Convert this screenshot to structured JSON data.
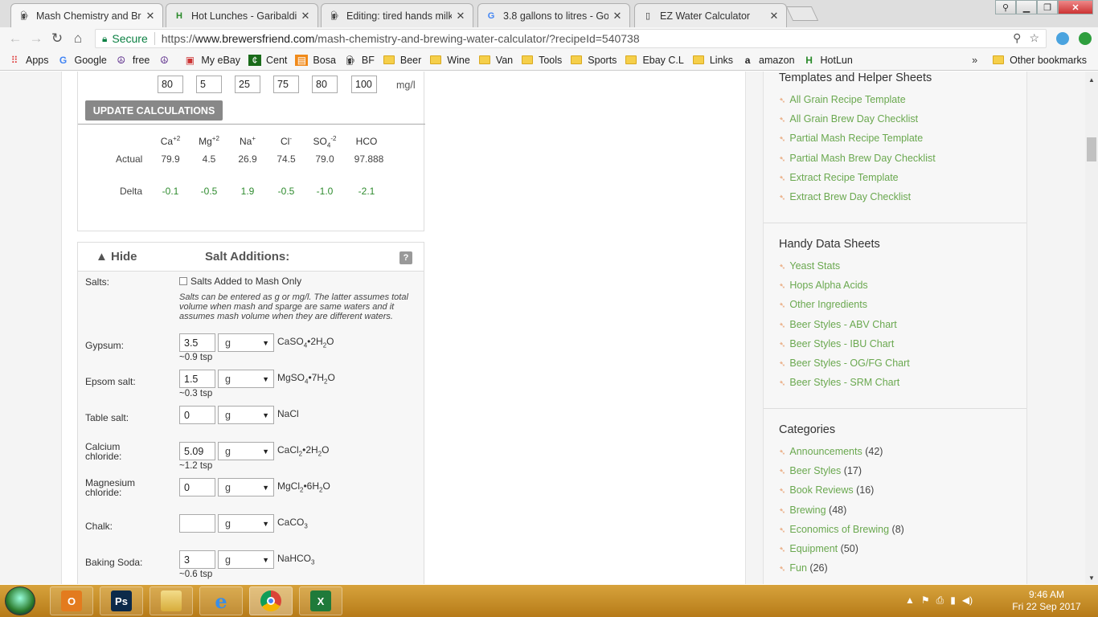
{
  "browser": {
    "tabs": [
      {
        "title": "Mash Chemistry and Bre",
        "icon": "beer-mug-icon",
        "active": true
      },
      {
        "title": "Hot Lunches - Garibaldi",
        "icon": "hotlunch-icon",
        "active": false
      },
      {
        "title": "Editing: tired hands milk",
        "icon": "beer-mug-icon",
        "active": false
      },
      {
        "title": "3.8 gallons to litres - Goo",
        "icon": "google-g-icon",
        "active": false
      },
      {
        "title": "EZ Water Calculator",
        "icon": "page-icon",
        "active": false
      }
    ],
    "secure_label": "Secure",
    "url_prefix": "https://",
    "url_domain": "www.brewersfriend.com",
    "url_path": "/mash-chemistry-and-brewing-water-calculator/?recipeId=540738",
    "bookmarks": [
      {
        "label": "Apps",
        "icon": "apps-grid-icon"
      },
      {
        "label": "Google",
        "icon": "google-g-icon"
      },
      {
        "label": "free",
        "icon": "peace-icon"
      },
      {
        "label": "",
        "icon": "peace-icon"
      },
      {
        "label": "My eBay",
        "icon": "shopping-bag-icon"
      },
      {
        "label": "Cent",
        "icon": "cent-icon"
      },
      {
        "label": "Bosa",
        "icon": "bosa-icon"
      },
      {
        "label": "BF",
        "icon": "beer-mug-icon"
      },
      {
        "label": "Beer",
        "icon": "folder-icon"
      },
      {
        "label": "Wine",
        "icon": "folder-icon"
      },
      {
        "label": "Van",
        "icon": "folder-icon"
      },
      {
        "label": "Tools",
        "icon": "folder-icon"
      },
      {
        "label": "Sports",
        "icon": "folder-icon"
      },
      {
        "label": "Ebay C.L",
        "icon": "folder-icon"
      },
      {
        "label": "Links",
        "icon": "folder-icon"
      },
      {
        "label": "amazon",
        "icon": "amazon-icon"
      },
      {
        "label": "HotLun",
        "icon": "hotlunch-icon"
      }
    ],
    "more_bookmarks": "»",
    "other_bookmarks": "Other bookmarks"
  },
  "water_profile": {
    "targets": [
      "80",
      "5",
      "25",
      "75",
      "80",
      "100"
    ],
    "unit": "mg/l",
    "update_button": "UPDATE CALCULATIONS",
    "headers": [
      {
        "base": "Ca",
        "sup": "+2",
        "sub": ""
      },
      {
        "base": "Mg",
        "sup": "+2",
        "sub": ""
      },
      {
        "base": "Na",
        "sup": "+",
        "sub": ""
      },
      {
        "base": "Cl",
        "sup": "-",
        "sub": ""
      },
      {
        "base": "SO",
        "sup": "-2",
        "sub": "4"
      },
      {
        "base": "HCO",
        "sup": "",
        "sub": ""
      }
    ],
    "actual_label": "Actual",
    "actual": [
      "79.9",
      "4.5",
      "26.9",
      "74.5",
      "79.0",
      "97.888"
    ],
    "delta_label": "Delta",
    "delta": [
      "-0.1",
      "-0.5",
      "1.9",
      "-0.5",
      "-1.0",
      "-2.1"
    ]
  },
  "salt_additions": {
    "hide_label": "▲ Hide",
    "title": "Salt Additions:",
    "help": "?",
    "salts_label": "Salts:",
    "mash_only_label": "Salts Added to Mash Only",
    "note": "Salts can be entered as g or mg/l. The latter assumes total volume when mash and sparge are same waters and it assumes mash volume when they are different waters.",
    "rows": [
      {
        "name": "Gypsum:",
        "amount": "3.5",
        "unit": "g",
        "formula": [
          [
            "CaSO",
            "4"
          ],
          [
            "•2H",
            "2"
          ],
          [
            "O",
            ""
          ]
        ],
        "tsp": "~0.9 tsp"
      },
      {
        "name": "Epsom salt:",
        "amount": "1.5",
        "unit": "g",
        "formula": [
          [
            "MgSO",
            "4"
          ],
          [
            "•7H",
            "2"
          ],
          [
            "O",
            ""
          ]
        ],
        "tsp": "~0.3 tsp"
      },
      {
        "name": "Table salt:",
        "amount": "0",
        "unit": "g",
        "formula": [
          [
            "NaCl",
            ""
          ]
        ],
        "tsp": ""
      },
      {
        "name": "Calcium chloride:",
        "amount": "5.09",
        "unit": "g",
        "formula": [
          [
            "CaCl",
            "2"
          ],
          [
            "•2H",
            "2"
          ],
          [
            "O",
            ""
          ]
        ],
        "tsp": "~1.2 tsp"
      },
      {
        "name": "Magnesium chloride:",
        "amount": "0",
        "unit": "g",
        "formula": [
          [
            "MgCl",
            "2"
          ],
          [
            "•6H",
            "2"
          ],
          [
            "O",
            ""
          ]
        ],
        "tsp": ""
      },
      {
        "name": "Chalk:",
        "amount": "",
        "unit": "g",
        "formula": [
          [
            "CaCO",
            "3"
          ]
        ],
        "tsp": ""
      },
      {
        "name": "Baking Soda:",
        "amount": "3",
        "unit": "g",
        "formula": [
          [
            "NaHCO",
            "3"
          ]
        ],
        "tsp": "~0.6 tsp"
      }
    ]
  },
  "sidebar": {
    "templates_title": "Templates and Helper Sheets",
    "templates": [
      "All Grain Recipe Template",
      "All Grain Brew Day Checklist",
      "Partial Mash Recipe Template",
      "Partial Mash Brew Day Checklist",
      "Extract Recipe Template",
      "Extract Brew Day Checklist"
    ],
    "handy_title": "Handy Data Sheets",
    "handy": [
      "Yeast Stats",
      "Hops Alpha Acids",
      "Other Ingredients",
      "Beer Styles - ABV Chart",
      "Beer Styles - IBU Chart",
      "Beer Styles - OG/FG Chart",
      "Beer Styles - SRM Chart"
    ],
    "categories_title": "Categories",
    "categories": [
      {
        "name": "Announcements",
        "count": "(42)"
      },
      {
        "name": "Beer Styles",
        "count": "(17)"
      },
      {
        "name": "Book Reviews",
        "count": "(16)"
      },
      {
        "name": "Brewing",
        "count": "(48)"
      },
      {
        "name": "Economics of Brewing",
        "count": "(8)"
      },
      {
        "name": "Equipment",
        "count": "(50)"
      },
      {
        "name": "Fun",
        "count": "(26)"
      }
    ]
  },
  "taskbar": {
    "apps": [
      {
        "name": "outlook",
        "icon": "outlook-icon",
        "color": "#e37b1e",
        "glyph": "O"
      },
      {
        "name": "photoshop",
        "icon": "photoshop-icon",
        "color": "#0c2a4a",
        "glyph": "Ps"
      },
      {
        "name": "explorer",
        "icon": "file-explorer-icon",
        "color": "#e6c35a",
        "glyph": ""
      },
      {
        "name": "ie",
        "icon": "internet-explorer-icon",
        "color": "#1e6fc9",
        "glyph": "e"
      },
      {
        "name": "chrome",
        "icon": "chrome-icon",
        "color": "#d33",
        "glyph": ""
      },
      {
        "name": "excel",
        "icon": "excel-icon",
        "color": "#1f7a3a",
        "glyph": "X"
      }
    ],
    "time": "9:46 AM",
    "date": "Fri 22 Sep 2017"
  }
}
